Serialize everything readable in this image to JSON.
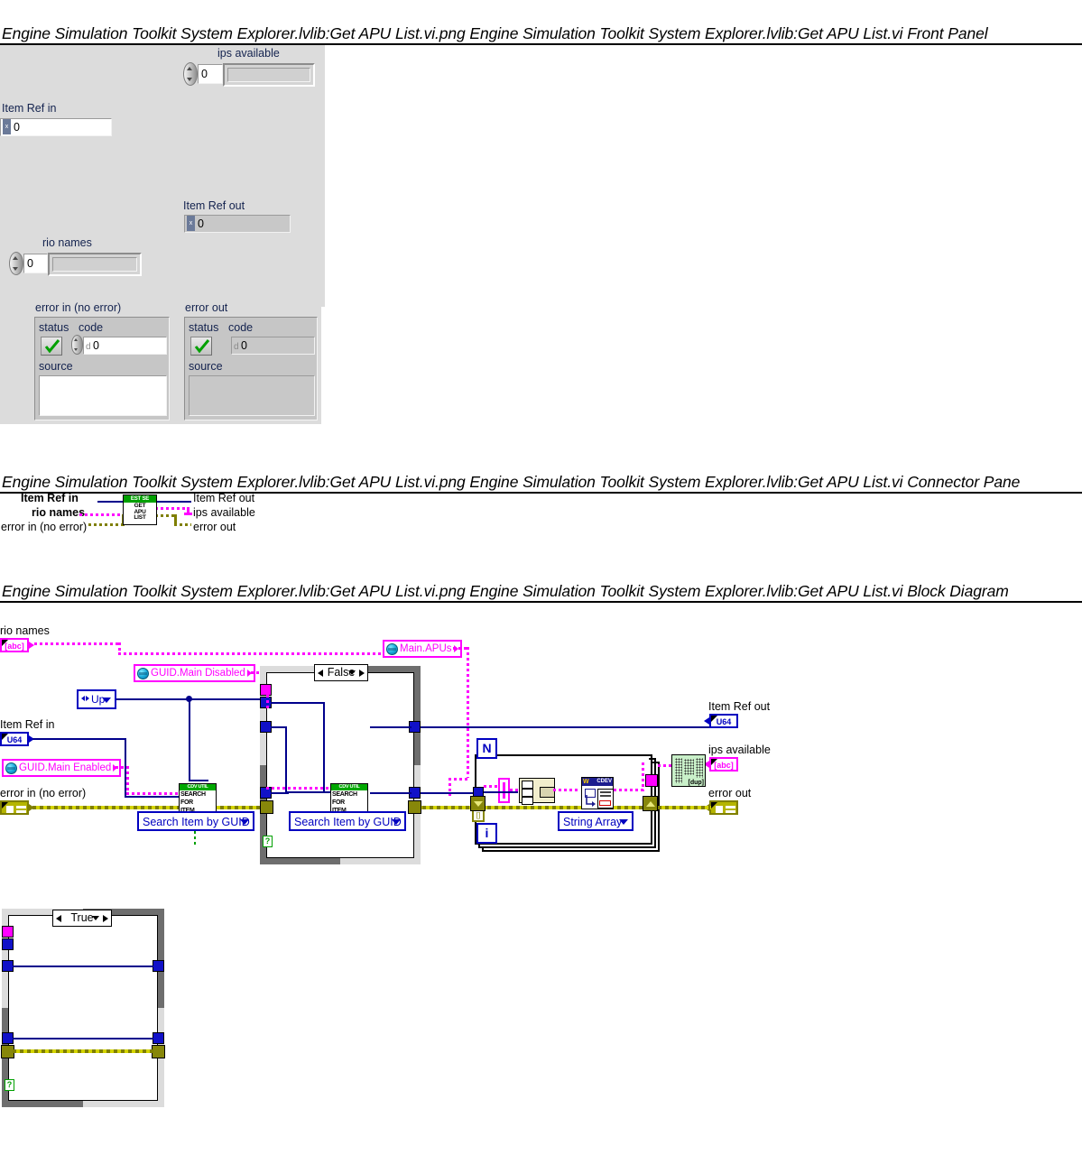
{
  "sections": {
    "front_panel": {
      "title": "Engine Simulation Toolkit System Explorer.lvlib:Get APU List.vi.png  Engine Simulation Toolkit System Explorer.lvlib:Get APU List.vi Front Panel"
    },
    "connector_pane": {
      "title": "Engine Simulation Toolkit System Explorer.lvlib:Get APU List.vi.png  Engine Simulation Toolkit System Explorer.lvlib:Get APU List.vi Connector Pane"
    },
    "block_diagram": {
      "title": "Engine Simulation Toolkit System Explorer.lvlib:Get APU List.vi.png  Engine Simulation Toolkit System Explorer.lvlib:Get APU List.vi Block Diagram"
    }
  },
  "front_panel": {
    "ips_available": {
      "label": "ips available",
      "index_value": "0",
      "element_value": ""
    },
    "item_ref_in": {
      "label": "Item Ref in",
      "value": "0",
      "type_badge": "x"
    },
    "item_ref_out": {
      "label": "Item Ref out",
      "value": "0",
      "type_badge": "x"
    },
    "rio_names": {
      "label": "rio names",
      "index_value": "0",
      "element_value": ""
    },
    "error_in": {
      "label": "error in (no error)",
      "status_label": "status",
      "code_label": "code",
      "code_value": "0",
      "code_badge": "d",
      "source_label": "source",
      "source_value": ""
    },
    "error_out": {
      "label": "error out",
      "status_label": "status",
      "code_label": "code",
      "code_value": "0",
      "code_badge": "d",
      "source_label": "source",
      "source_value": ""
    }
  },
  "connector_pane": {
    "inputs": [
      {
        "label": "Item Ref in"
      },
      {
        "label": "rio names"
      },
      {
        "label": "error in (no error)"
      }
    ],
    "outputs": [
      {
        "label": "Item Ref out"
      },
      {
        "label": "ips available"
      },
      {
        "label": "error out"
      }
    ],
    "icon": {
      "banner": "EST SE",
      "line1": "GET",
      "line2": "APU",
      "line3": "LIST"
    }
  },
  "block_diagram": {
    "terminals": {
      "rio_names": {
        "label": "rio names",
        "glyph": "[abc]"
      },
      "item_ref_in": {
        "label": "Item Ref in",
        "glyph": "U64"
      },
      "error_in": {
        "label": "error in (no error)",
        "glyph": ""
      },
      "item_ref_out": {
        "label": "Item Ref out",
        "glyph": "U64"
      },
      "ips_available": {
        "label": "ips available",
        "glyph": "[abc]"
      },
      "error_out": {
        "label": "error out",
        "glyph": ""
      }
    },
    "constants": {
      "guid_main_disabled": "GUID.Main Disabled",
      "guid_main_enabled": "GUID.Main Enabled",
      "main_apus": "Main.APUs",
      "up_enum": "Up"
    },
    "case_structures": [
      {
        "name": "outer-case",
        "selector": "False"
      },
      {
        "name": "true-case",
        "selector": "True"
      }
    ],
    "subvis": [
      {
        "name": "search-for-item-1",
        "banner": "CDV UTIL",
        "line1": "SEARCH",
        "line2": "FOR",
        "line3": "ITEM",
        "ring": "Search Item by GUID"
      },
      {
        "name": "search-for-item-2",
        "banner": "CDV UTIL",
        "line1": "SEARCH",
        "line2": "FOR",
        "line3": "ITEM",
        "ring": "Search Item by GUID"
      },
      {
        "name": "cdev-read",
        "banner": "CDEV",
        "ring": "String Array"
      },
      {
        "name": "remove-duplicates",
        "badge": "[dup]"
      }
    ],
    "loop": {
      "count_terminal": "N",
      "iteration_terminal": "i"
    }
  }
}
